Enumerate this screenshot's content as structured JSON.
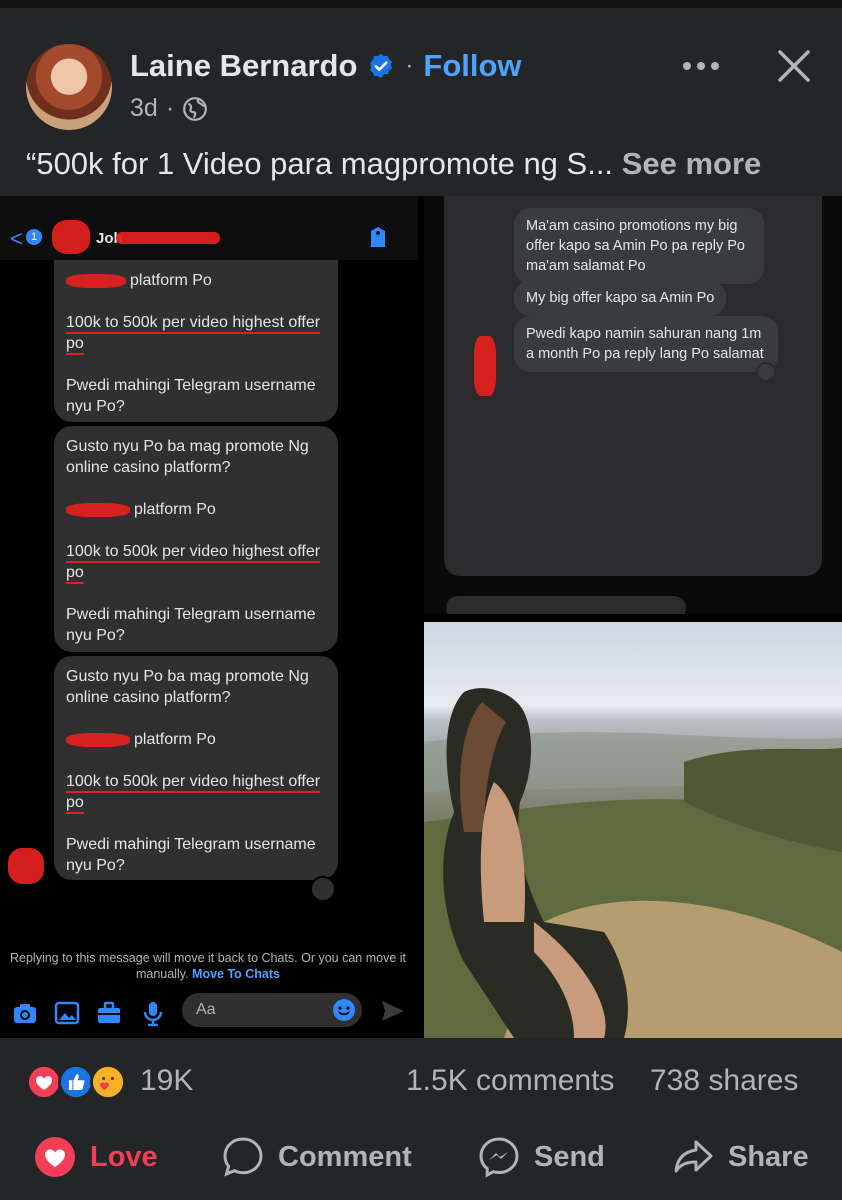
{
  "post": {
    "author": "Laine Bernardo",
    "follow_label": "Follow",
    "separator": "·",
    "age": "3d",
    "age_separator": "·",
    "caption": "“500k for 1 Video para magpromote ng S...",
    "see_more": "See more"
  },
  "chat_left": {
    "back_count": "1",
    "contact_name": "Joh",
    "bubbles": [
      {
        "lines": [
          "platform Po",
          "100k to 500k per video highest offer po",
          "Pwedi mahingi Telegram username nyu Po?"
        ]
      },
      {
        "lines": [
          "Gusto nyu Po ba mag promote Ng online casino platform?",
          "platform Po",
          "100k to 500k per video highest offer po",
          "Pwedi mahingi Telegram username nyu Po?"
        ]
      },
      {
        "lines": [
          "Gusto nyu Po ba mag promote Ng online casino platform?",
          "platform Po",
          "100k to 500k per video highest offer po",
          "Pwedi mahingi Telegram username nyu Po?"
        ]
      }
    ],
    "underlined": "100k to 500k",
    "reply_note": "Replying to this message will move it back to Chats. Or you can move it manually.",
    "move_link": "Move To Chats",
    "composer_placeholder": "Aa"
  },
  "chat_right": {
    "messages": [
      "Ma'am casino promotions my big offer kapo sa Amin Po pa reply Po ma'am salamat Po",
      "My big offer kapo sa Amin Po",
      "Pwedi kapo namin sahuran nang 1m a month Po pa reply lang Po salamat"
    ]
  },
  "stats": {
    "reaction_count": "19K",
    "comments": "1.5K comments",
    "shares": "738 shares"
  },
  "actions": {
    "love": "Love",
    "comment": "Comment",
    "send": "Send",
    "share": "Share"
  },
  "colors": {
    "accent": "#4da3ff",
    "love": "#f33e58",
    "background": "#242526",
    "redaction": "#e0211f"
  }
}
